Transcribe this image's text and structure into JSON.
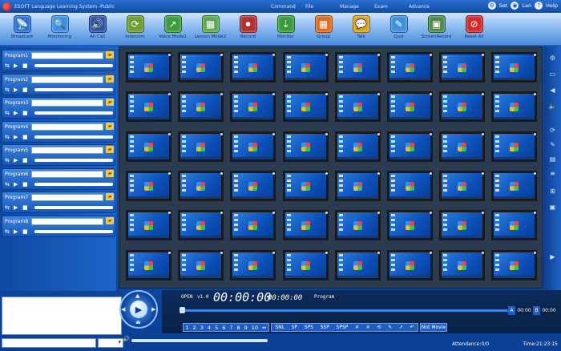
{
  "window": {
    "title": "ESOFT Language Learning System -Public",
    "menu": [
      "Command",
      "File",
      "Manage",
      "Exam",
      "Advance"
    ],
    "right_controls": [
      {
        "icon": "gear-icon",
        "label": "Set"
      },
      {
        "icon": "globe-icon",
        "label": "Lan"
      },
      {
        "icon": "help-icon",
        "label": "Help"
      }
    ]
  },
  "toolbar": [
    {
      "label": "Broadcast",
      "icon": "broadcast-icon",
      "color": "#2a6fd6"
    },
    {
      "label": "Monitoring",
      "icon": "monitor-magnifier-icon",
      "color": "#3a8fe6"
    },
    {
      "label": "All Call",
      "icon": "speaker-call-icon",
      "color": "#2d4fa0"
    },
    {
      "label": "Intercom",
      "icon": "intercom-icon",
      "color": "#6d9f2f"
    },
    {
      "label": "Voice Mode1",
      "icon": "voice-mode-icon",
      "color": "#3d9d3d"
    },
    {
      "label": "Lesson Mode2",
      "icon": "lesson-mode-icon",
      "color": "#5aa850"
    },
    {
      "label": "Record",
      "icon": "record-icon",
      "color": "#b23030"
    },
    {
      "label": "Monitor",
      "icon": "monitor-icon",
      "color": "#3b9a3b"
    },
    {
      "label": "Group",
      "icon": "group-icon",
      "color": "#e06a1a"
    },
    {
      "label": "Talk",
      "icon": "talk-icon",
      "color": "#d9a020"
    },
    {
      "label": "Quiz",
      "icon": "quiz-icon",
      "color": "#3e8ed9"
    },
    {
      "label": "ScreenRecord",
      "icon": "screen-record-icon",
      "color": "#4a8a4a"
    },
    {
      "label": "Reset All",
      "icon": "reset-all-icon",
      "color": "#d02a2a"
    }
  ],
  "programs": [
    {
      "label": "Program1"
    },
    {
      "label": "Program2"
    },
    {
      "label": "Program3"
    },
    {
      "label": "Program4"
    },
    {
      "label": "Program5"
    },
    {
      "label": "Program6"
    },
    {
      "label": "Program7"
    },
    {
      "label": "Program8"
    }
  ],
  "monitor_grid": {
    "rows": 6,
    "cols": 8
  },
  "right_icons": [
    "settings-icon",
    "screen-icon",
    "speaker-icon",
    "volume-icon",
    "refresh-icon",
    "edit-icon",
    "grid-icon",
    "list-icon",
    "windows-icon",
    "screen-icon-2",
    "play-icon"
  ],
  "player": {
    "open_label": "OPEN",
    "version": "v1.0",
    "time_main": "00:00:00",
    "time_total": "00:00:00",
    "program_label": "Program",
    "a_label": "A",
    "a_time": "00:00",
    "b_label": "B",
    "b_time": "00:00",
    "numbers": [
      "1",
      "2",
      "3",
      "4",
      "5",
      "6",
      "7",
      "8",
      "9",
      "10"
    ],
    "modes": [
      "SNL",
      "SP",
      "SPS",
      "SSP",
      "SPSP"
    ],
    "not_movie": "Not Movie"
  },
  "status": {
    "attendance": "Attendance:0/0",
    "time": "Time:21:23:15"
  }
}
